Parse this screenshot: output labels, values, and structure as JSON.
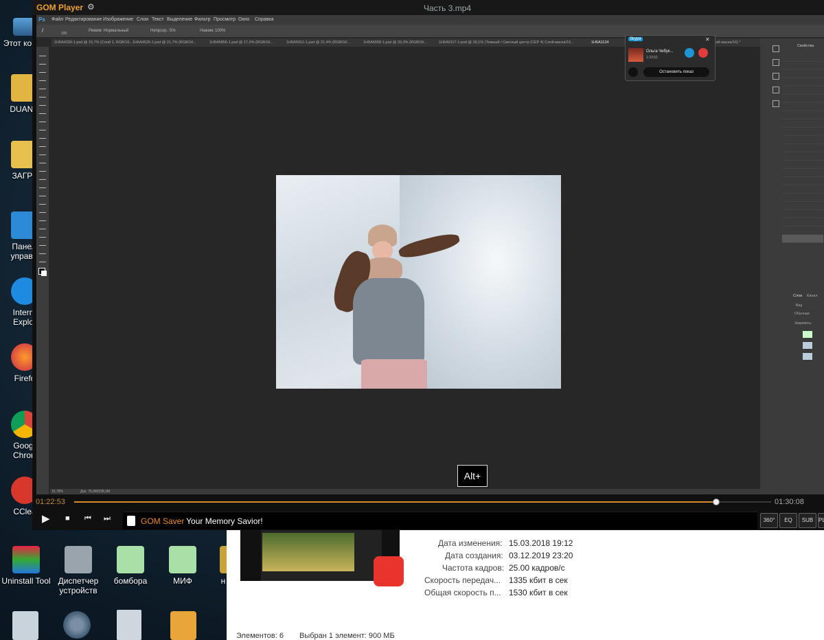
{
  "window": {
    "app_name": "GOM Player",
    "title": "Часть 3.mp4"
  },
  "desktop_icons": [
    {
      "label": "Этот компь"
    },
    {
      "label": "DUANG"
    },
    {
      "label": "ЗАГРУ"
    },
    {
      "label": "Панел управл"
    },
    {
      "label": "Intern Explo"
    },
    {
      "label": "Firefo"
    },
    {
      "label": "Goog Chror"
    },
    {
      "label": "CClea"
    },
    {
      "label": "Uninstall Tool"
    },
    {
      "label": "Диспетчер устройств"
    },
    {
      "label": "бомбора"
    },
    {
      "label": "МИФ"
    },
    {
      "label": "н"
    }
  ],
  "photoshop": {
    "logo": "Ps",
    "menu": [
      "Файл",
      "Редактирование",
      "Изображение",
      "Слои",
      "Текст",
      "Выделение",
      "Фильтр",
      "Просмотр",
      "Окно",
      "Справка"
    ],
    "options": {
      "mode_label": "Режим:",
      "mode_value": "Нормальный",
      "opacity_label": "Непрозр.:",
      "opacity_value": "5%",
      "flow_label": "Нажим:",
      "flow_value": "100%",
      "brush_size": "100"
    },
    "tabs": [
      "1H5A4330-1.psd @ 15,7% (Слой 1, RGB/16...",
      "1H5A4526-1.psd @ 21,7% (RGB/16...",
      "1H5A5856-1.psd @ 17,5% (RGB/16...",
      "1H5A5912-1.psd @ 21,4% (RGB/16...",
      "1H5A6658-1.psd @ 33,3% (RGB/16...",
      "1H5A9117-1.psd @ 18,1% (Темный / Светлый центр (CEP 4) Слой-маска/16...",
      "1H5A1124",
      "Слой-маска/16) *"
    ],
    "status_zoom": "15,78%",
    "status_doc": "Док: 76,4M/238,3M",
    "right_panel": {
      "tab": "Свойства",
      "layers_tab": "Слои",
      "channels_tab": "Канал",
      "search_placeholder": "Вид",
      "blend": "Обычные",
      "lock": "Закрепить:"
    }
  },
  "skype": {
    "badge": "Skype",
    "caller": "Ольга Чебук...",
    "duration": "1:33:52",
    "stop_button": "Остановить показ"
  },
  "overlay": {
    "alt_hint": "Alt+"
  },
  "player": {
    "current_time": "01:22:53",
    "total_time": "01:30:08",
    "progress": 0.92,
    "banner_brand": "GOM Saver",
    "banner_text": " Your Memory Savior!",
    "buttons": {
      "deg360": "360°",
      "eq": "EQ",
      "sub": "SUB",
      "pl": "PL"
    }
  },
  "file_info": {
    "props": [
      {
        "label": "Дата изменения:",
        "value": "15.03.2018 19:12"
      },
      {
        "label": "Дата создания:",
        "value": "03.12.2019 23:20"
      },
      {
        "label": "Частота кадров:",
        "value": "25.00 кадров/с"
      },
      {
        "label": "Скорость передач...",
        "value": "1335 кбит в сек"
      },
      {
        "label": "Общая скорость п...",
        "value": "1530 кбит в сек"
      }
    ]
  },
  "explorer_status": {
    "items": "Элементов: 6",
    "selected": "Выбран 1 элемент: 900 МБ"
  }
}
